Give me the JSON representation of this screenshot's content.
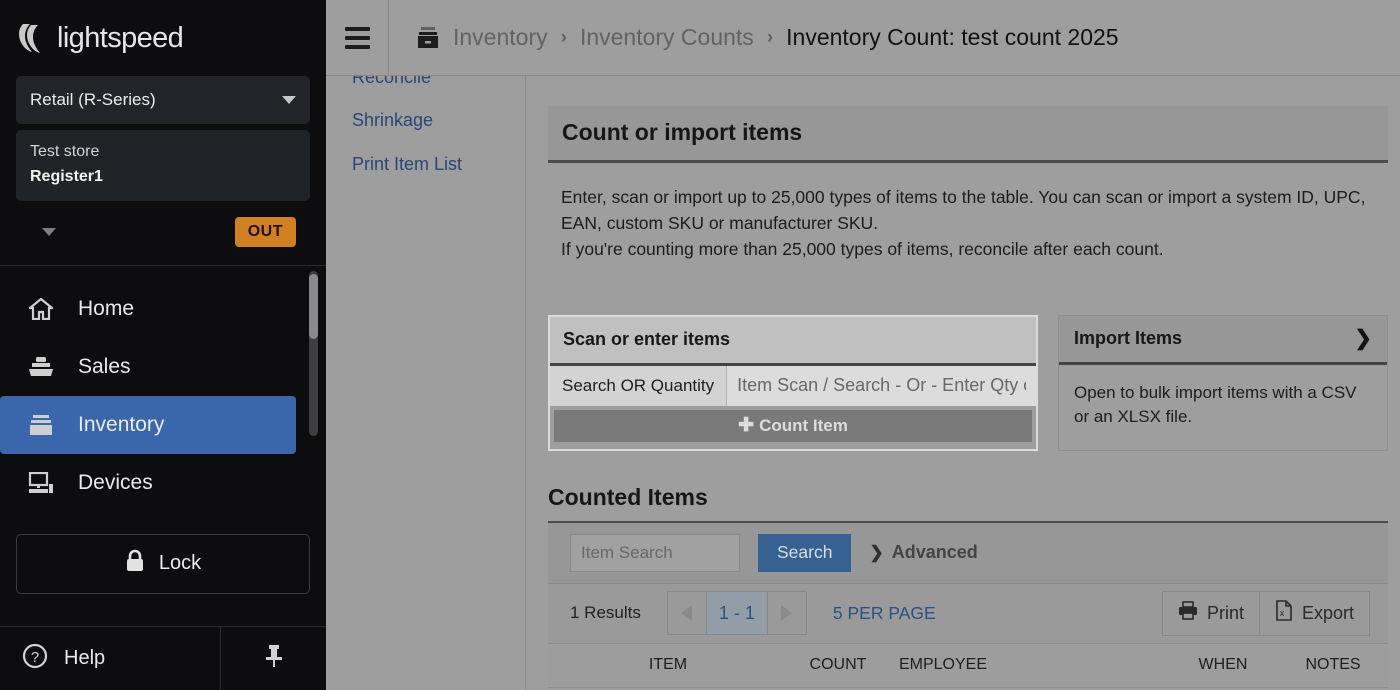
{
  "sidebar": {
    "brand": "lightspeed",
    "brand_logo_icon": "lightspeed-logo-icon",
    "store_select": {
      "label": "Retail (R-Series)",
      "caret_icon": "chevron-down-icon"
    },
    "register": {
      "store": "Test store",
      "name": "Register1"
    },
    "clock_row": {
      "caret_icon": "chevron-down-icon",
      "status_label": "OUT"
    },
    "nav_items": [
      {
        "label": "Home",
        "icon": "home-icon",
        "active": false
      },
      {
        "label": "Sales",
        "icon": "sales-register-icon",
        "active": false
      },
      {
        "label": "Inventory",
        "icon": "inventory-box-icon",
        "active": true
      },
      {
        "label": "Devices",
        "icon": "devices-monitor-icon",
        "active": false
      }
    ],
    "lock_button": {
      "label": "Lock",
      "icon": "lock-icon"
    },
    "footer": {
      "help_label": "Help",
      "help_icon": "question-circle-icon",
      "pin_icon": "pin-icon"
    }
  },
  "topbar": {
    "menu_icon": "hamburger-menu-icon",
    "crumb_icon": "inventory-box-icon",
    "breadcrumbs": [
      {
        "label": "Inventory",
        "current": false
      },
      {
        "label": "Inventory Counts",
        "current": false
      },
      {
        "label": "Inventory Count:  test count 2025",
        "current": true
      }
    ],
    "separator": "›"
  },
  "subnav": {
    "links": [
      {
        "label": "Reconcile"
      },
      {
        "label": "Shrinkage"
      },
      {
        "label": "Print Item List"
      }
    ]
  },
  "main": {
    "count_panel": {
      "title": "Count or import items",
      "paragraph_1": "Enter, scan or import up to 25,000 types of items to the table. You can scan or import a system ID, UPC, EAN, custom SKU or manufacturer SKU.",
      "paragraph_2": "If you're counting more than 25,000 types of items, reconcile after each count."
    },
    "scan_card": {
      "title": "Scan or enter items",
      "addon_label": "Search OR Quantity",
      "input_value": "",
      "input_placeholder": "Item Scan / Search - Or - Enter Qty o",
      "count_button_label": "Count Item",
      "count_button_icon": "plus-icon"
    },
    "import_card": {
      "title": "Import Items",
      "expand_icon": "chevron-right-icon",
      "description": "Open to bulk import items with a CSV or an XLSX file."
    },
    "counted_items": {
      "title": "Counted Items",
      "search": {
        "input_value": "",
        "input_placeholder": "Item Search",
        "button_label": "Search",
        "advanced_label": "Advanced",
        "advanced_icon": "chevron-right-icon"
      },
      "pager": {
        "results_label": "1 Results",
        "prev_icon": "triangle-left-icon",
        "current_range": "1 - 1",
        "next_icon": "triangle-right-icon",
        "per_page_label": "5 PER PAGE"
      },
      "actions": [
        {
          "label": "Print",
          "icon": "printer-icon"
        },
        {
          "label": "Export",
          "icon": "excel-file-icon"
        }
      ],
      "columns": [
        "ITEM",
        "COUNT",
        "EMPLOYEE",
        "WHEN",
        "NOTES"
      ]
    }
  },
  "colors": {
    "sidebar_bg": "#0d0d10",
    "nav_active": "#3a67ab",
    "out_badge": "#d08020",
    "link_blue": "#2a4d86",
    "search_button": "#3a6da8",
    "page_bg": "#b5b5b5"
  }
}
